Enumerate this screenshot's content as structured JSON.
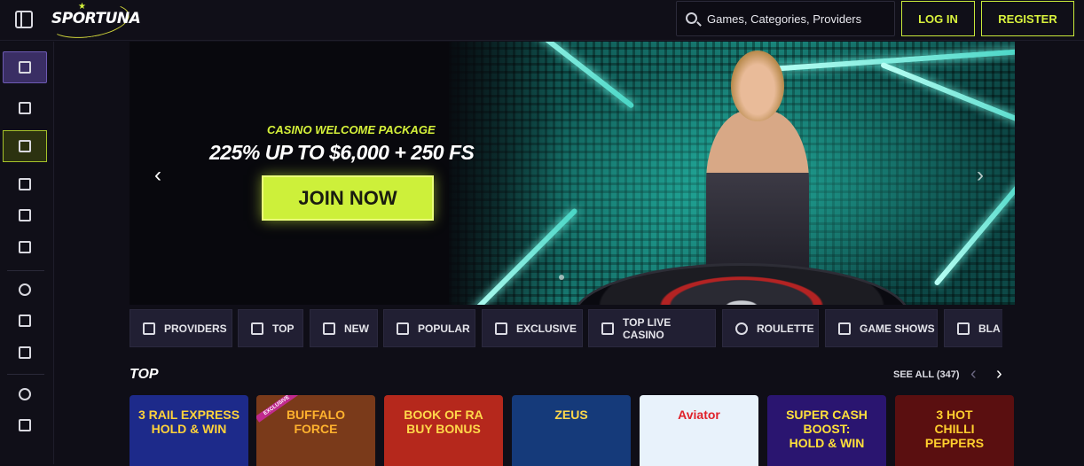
{
  "header": {
    "logo": "SPORTUNA",
    "search_placeholder": "Games, Categories, Providers",
    "login_label": "LOG IN",
    "register_label": "REGISTER"
  },
  "sidebar": {
    "items": [
      {
        "icon": "cup-icon",
        "state": "active-purple"
      },
      {
        "icon": "gift-icon",
        "state": "normal"
      },
      {
        "icon": "home-icon",
        "state": "active-green"
      },
      {
        "icon": "coupon-icon",
        "state": "normal"
      },
      {
        "icon": "mobile-icon",
        "state": "normal"
      },
      {
        "icon": "seven-icon",
        "state": "normal"
      },
      {
        "icon": "soccer-ball-icon",
        "state": "normal"
      },
      {
        "icon": "video-icon",
        "state": "normal"
      },
      {
        "icon": "gamepad-icon",
        "state": "normal"
      },
      {
        "icon": "award-icon",
        "state": "normal"
      },
      {
        "icon": "trophy-icon",
        "state": "normal"
      }
    ]
  },
  "hero": {
    "kicker": "CASINO WELCOME PACKAGE",
    "title": "225% UP TO $6,000 + 250 FS",
    "cta": "JOIN NOW",
    "prev": "‹",
    "next": "›"
  },
  "categories": [
    {
      "label": "PROVIDERS",
      "icon": "layers-icon"
    },
    {
      "label": "TOP",
      "icon": "crown-icon"
    },
    {
      "label": "NEW",
      "icon": "bolt-icon"
    },
    {
      "label": "POPULAR",
      "icon": "flame-icon"
    },
    {
      "label": "EXCLUSIVE",
      "icon": "diamond-icon"
    },
    {
      "label": "TOP LIVE CASINO",
      "icon": "cards-icon"
    },
    {
      "label": "ROULETTE",
      "icon": "roulette-icon"
    },
    {
      "label": "GAME SHOWS",
      "icon": "microphone-icon"
    },
    {
      "label": "BLA",
      "icon": "blackjack-icon"
    }
  ],
  "top_section": {
    "title": "TOP",
    "see_all": "SEE ALL (347)",
    "prev": "‹",
    "next": "›",
    "games": [
      {
        "name": "3 RAIL EXPRESS\nHOLD & WIN",
        "bg": "#1d2a8a",
        "color": "#ffd23a"
      },
      {
        "name": "BUFFALO\nFORCE",
        "bg": "#7a3a1a",
        "color": "#ffb22e",
        "badge": "EXCLUSIVE"
      },
      {
        "name": "BOOK OF RA\nBUY BONUS",
        "bg": "#b5281c",
        "color": "#ffd84a"
      },
      {
        "name": "ZEUS",
        "bg": "#153a7a",
        "color": "#ffd84a"
      },
      {
        "name": "Aviator",
        "bg": "#e8f2fb",
        "color": "#e0212a"
      },
      {
        "name": "SUPER CASH BOOST:\nHOLD & WIN",
        "bg": "#2a1570",
        "color": "#ffe03a"
      },
      {
        "name": "3 HOT\nCHILLI\nPEPPERS",
        "bg": "#5a0f10",
        "color": "#ffcf2e"
      }
    ]
  }
}
